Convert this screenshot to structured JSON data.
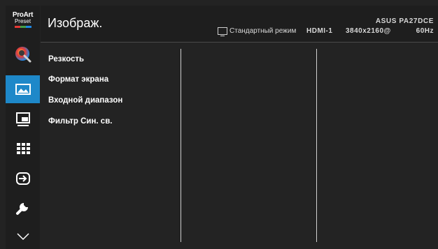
{
  "sidebar": {
    "proart_preset": {
      "line1": "ProArt",
      "line2": "Preset"
    },
    "items": [
      {
        "icon": "color-icon"
      },
      {
        "icon": "image-icon",
        "active": true
      },
      {
        "icon": "pip-icon"
      },
      {
        "icon": "grid-icon"
      },
      {
        "icon": "input-select-icon"
      },
      {
        "icon": "wrench-icon"
      },
      {
        "icon": "chevron-down-icon"
      }
    ]
  },
  "header": {
    "title": "Изображ.",
    "mode": "Стандартный режим",
    "model": "ASUS PA27DCE",
    "input": "HDMI-1",
    "resolution": "3840x2160@",
    "refresh": "60Hz"
  },
  "menu": {
    "items": [
      "Резкость",
      "Формат экрана",
      "Входной диапазон",
      "Фильтр Син. св."
    ]
  },
  "colors": {
    "accent": "#1e88c9",
    "background": "#232323",
    "panel": "#1e1e1e"
  }
}
